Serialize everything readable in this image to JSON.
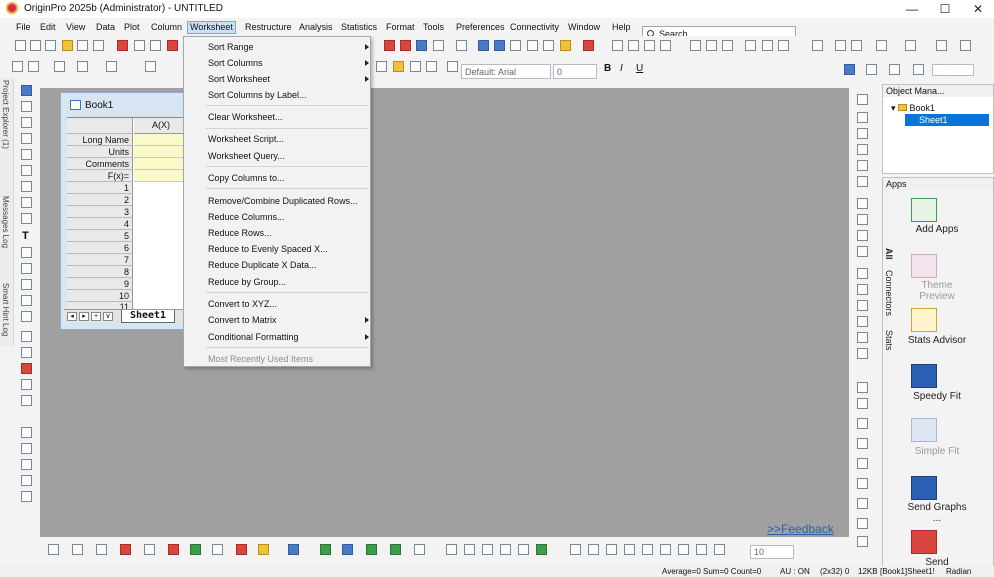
{
  "window": {
    "title": "OriginPro 2025b (Administrator) - UNTITLED",
    "minimize": "—",
    "maximize": "☐",
    "close": "✕"
  },
  "menu": [
    "File",
    "Edit",
    "View",
    "Data",
    "Plot",
    "Column",
    "Worksheet",
    "Restructure",
    "Analysis",
    "Statistics",
    "Format",
    "Tools",
    "Preferences",
    "Connectivity",
    "Window",
    "Help"
  ],
  "search": {
    "placeholder": "Search"
  },
  "font_toolbar": {
    "font": "Default: Arial",
    "size": "0"
  },
  "book": {
    "title": "Book1",
    "column_header": "A(X)",
    "row_labels": [
      "Long Name",
      "Units",
      "Comments",
      "F(x)="
    ],
    "rows": [
      "1",
      "2",
      "3",
      "4",
      "5",
      "6",
      "7",
      "8",
      "9",
      "10",
      "11"
    ],
    "sheet_tab": "Sheet1",
    "nav_buttons": [
      "◂",
      "▸",
      "+",
      "∨"
    ]
  },
  "worksheet_menu": {
    "items": [
      {
        "label": "Sort Range",
        "submenu": true
      },
      {
        "label": "Sort Columns",
        "submenu": true
      },
      {
        "label": "Sort Worksheet",
        "submenu": true
      },
      {
        "label": "Sort Columns by Label...",
        "submenu": false
      },
      {
        "label": "Clear Worksheet...",
        "submenu": false
      },
      {
        "label": "Worksheet Script...",
        "submenu": false
      },
      {
        "label": "Worksheet Query...",
        "submenu": false
      },
      {
        "label": "Copy Columns to...",
        "submenu": false
      },
      {
        "label": "Remove/Combine Duplicated Rows...",
        "submenu": false
      },
      {
        "label": "Reduce Columns...",
        "submenu": false
      },
      {
        "label": "Reduce Rows...",
        "submenu": false
      },
      {
        "label": "Reduce to Evenly Spaced X...",
        "submenu": false
      },
      {
        "label": "Reduce Duplicate X Data...",
        "submenu": false
      },
      {
        "label": "Reduce by Group...",
        "submenu": false
      },
      {
        "label": "Convert to XYZ...",
        "submenu": false
      },
      {
        "label": "Convert to Matrix",
        "submenu": true
      },
      {
        "label": "Conditional Formatting",
        "submenu": true
      },
      {
        "label": "Most Recently Used Items",
        "submenu": false,
        "disabled": true
      }
    ]
  },
  "left_side_tabs": [
    "Project Explorer (1)",
    "Messages Log",
    "Smart Hint Log"
  ],
  "object_manager": {
    "title": "Object Mana...",
    "tree_book": "Book1",
    "tree_sheet": "Sheet1"
  },
  "apps_panel": {
    "title": "Apps",
    "side_tabs": [
      "All",
      "Connectors",
      "Stats"
    ],
    "items": [
      {
        "label": "Add Apps",
        "enabled": true
      },
      {
        "label": "Theme Preview",
        "enabled": false
      },
      {
        "label": "Stats Advisor",
        "enabled": true
      },
      {
        "label": "Speedy Fit",
        "enabled": true
      },
      {
        "label": "Simple Fit",
        "enabled": false
      },
      {
        "label": "Send Graphs ...",
        "enabled": true
      },
      {
        "label": "Send",
        "enabled": true
      }
    ]
  },
  "feedback_link": ">>Feedback",
  "bottom_toolbar": {
    "size": "10"
  },
  "statusbar": {
    "stats": "Average=0 Sum=0 Count=0",
    "au": "AU : ON",
    "dims": "(2x32) 0",
    "mem": "12KB",
    "sheet": "[Book1]Sheet1!",
    "unit": "Radian"
  }
}
